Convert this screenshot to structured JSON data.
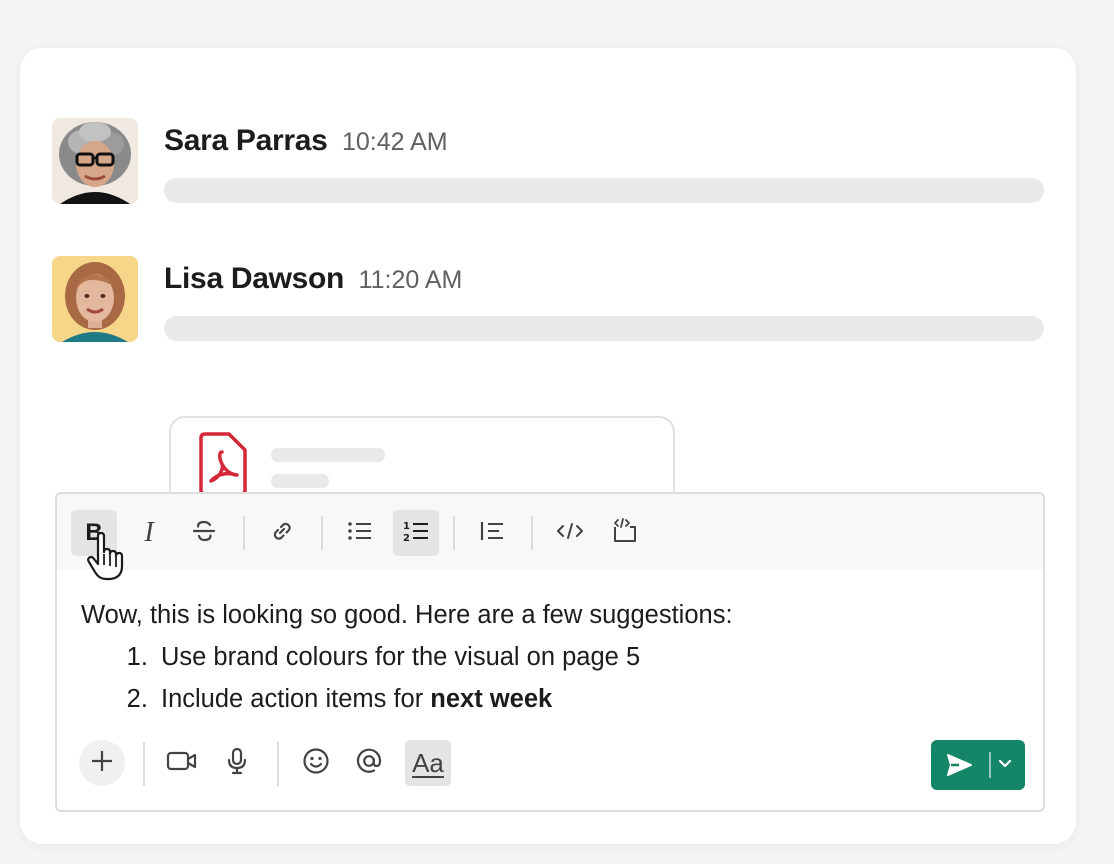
{
  "messages": [
    {
      "name": "Sara Parras",
      "time": "10:42 AM",
      "avatar_icon": "avatar-sara-parras"
    },
    {
      "name": "Lisa Dawson",
      "time": "11:20 AM",
      "avatar_icon": "avatar-lisa-dawson"
    }
  ],
  "attachment": {
    "type_icon": "pdf-file-icon",
    "accent_color": "#d3283a"
  },
  "toolbar": {
    "bold_label": "B",
    "italic_label": "I",
    "icons": [
      "strikethrough-icon",
      "link-icon",
      "bulleted-list-icon",
      "numbered-list-icon",
      "blockquote-icon",
      "code-icon",
      "code-block-icon"
    ],
    "active": [
      "bold",
      "numbered-list"
    ]
  },
  "editor": {
    "intro": "Wow, this is looking so good. Here are a few suggestions:",
    "items": [
      {
        "text": "Use brand colours for the visual on page 5"
      },
      {
        "text": "Include action items for ",
        "bold": "next week"
      }
    ]
  },
  "bottom_bar": {
    "icons": [
      "plus-icon",
      "video-icon",
      "microphone-icon",
      "emoji-icon",
      "mention-icon"
    ],
    "format_label": "Aa"
  },
  "send_button": {
    "color": "#148567",
    "icon": "send-icon"
  }
}
